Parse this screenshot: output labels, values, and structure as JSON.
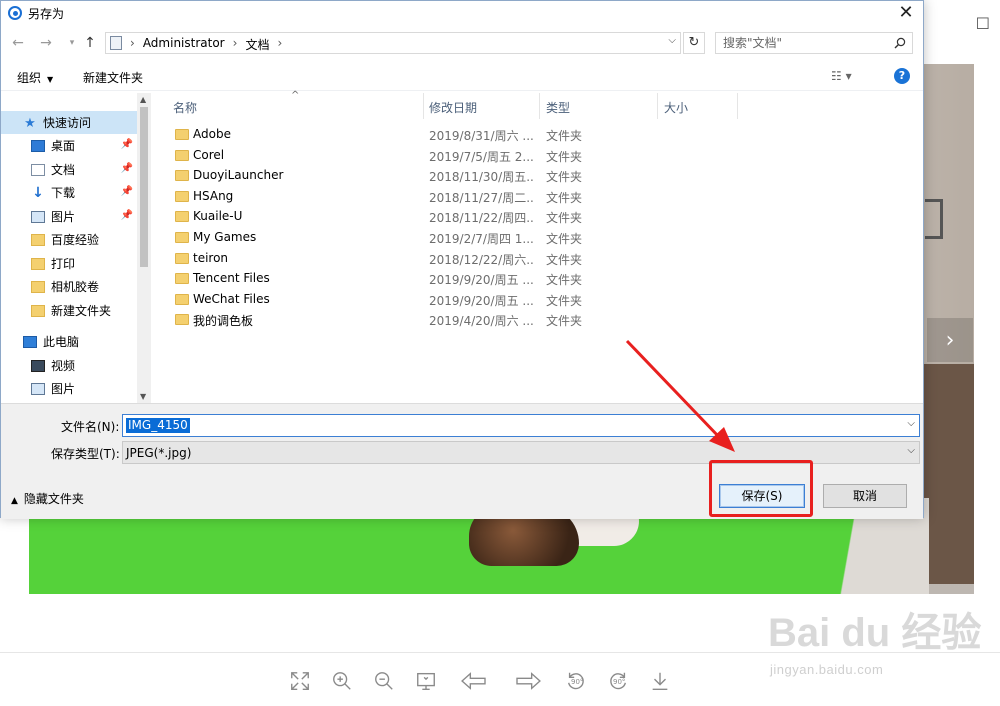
{
  "dialog": {
    "title": "另存为",
    "close_glyph": "✕",
    "address": {
      "crumbs": [
        "Administrator",
        "文档"
      ],
      "chevron": "›"
    },
    "search": {
      "placeholder": "搜索\"文档\""
    },
    "toolbar": {
      "organize_label": "组织",
      "new_folder_label": "新建文件夹",
      "help_label": "?"
    },
    "nav": {
      "items": [
        {
          "label": "快速访问",
          "icon": "star-icon",
          "pinned": false,
          "selected": true,
          "indent": false
        },
        {
          "label": "桌面",
          "icon": "desktop-icon",
          "pinned": true,
          "indent": true
        },
        {
          "label": "文档",
          "icon": "document-icon",
          "pinned": true,
          "indent": true
        },
        {
          "label": "下载",
          "icon": "download-icon",
          "pinned": true,
          "indent": true
        },
        {
          "label": "图片",
          "icon": "picture-icon",
          "pinned": true,
          "indent": true
        },
        {
          "label": "百度经验",
          "icon": "folder-icon",
          "pinned": false,
          "indent": true
        },
        {
          "label": "打印",
          "icon": "folder-icon",
          "pinned": false,
          "indent": true
        },
        {
          "label": "相机胶卷",
          "icon": "folder-icon",
          "pinned": false,
          "indent": true
        },
        {
          "label": "新建文件夹",
          "icon": "folder-icon",
          "pinned": false,
          "indent": true
        },
        {
          "label": "此电脑",
          "icon": "pc-icon",
          "pinned": false,
          "indent": false
        },
        {
          "label": "视频",
          "icon": "video-icon",
          "pinned": false,
          "indent": true
        },
        {
          "label": "图片",
          "icon": "picture-icon",
          "pinned": false,
          "indent": true
        }
      ]
    },
    "columns": {
      "name": "名称",
      "date": "修改日期",
      "type": "类型",
      "size": "大小"
    },
    "files": [
      {
        "name": "Adobe",
        "date": "2019/8/31/周六 ...",
        "type": "文件夹"
      },
      {
        "name": "Corel",
        "date": "2019/7/5/周五 2...",
        "type": "文件夹"
      },
      {
        "name": "DuoyiLauncher",
        "date": "2018/11/30/周五...",
        "type": "文件夹"
      },
      {
        "name": "HSAng",
        "date": "2018/11/27/周二...",
        "type": "文件夹"
      },
      {
        "name": "Kuaile-U",
        "date": "2018/11/22/周四...",
        "type": "文件夹"
      },
      {
        "name": "My Games",
        "date": "2019/2/7/周四 1...",
        "type": "文件夹"
      },
      {
        "name": "teiron",
        "date": "2018/12/22/周六...",
        "type": "文件夹"
      },
      {
        "name": "Tencent Files",
        "date": "2019/9/20/周五 ...",
        "type": "文件夹"
      },
      {
        "name": "WeChat Files",
        "date": "2019/9/20/周五 ...",
        "type": "文件夹"
      },
      {
        "name": "我的调色板",
        "date": "2019/4/20/周六 ...",
        "type": "文件夹"
      }
    ],
    "filename": {
      "label": "文件名(N):",
      "value": "IMG_4150"
    },
    "filetype": {
      "label": "保存类型(T):",
      "value": "JPEG(*.jpg)"
    },
    "hide_folders_label": "隐藏文件夹",
    "save_label": "保存(S)",
    "cancel_label": "取消"
  },
  "viewer": {
    "tools": [
      "fullscreen-icon",
      "zoom-in-icon",
      "zoom-out-icon",
      "original-size-icon",
      "prev-icon",
      "next-icon",
      "rotate-left-icon",
      "rotate-right-icon",
      "download-icon"
    ],
    "rotate_label": "90°"
  },
  "watermark": {
    "brand": "Bai du 经验",
    "url": "jingyan.baidu.com"
  },
  "colors": {
    "accent": "#1a73d6",
    "annotation": "#e8201f",
    "tray": "#55d23a"
  }
}
